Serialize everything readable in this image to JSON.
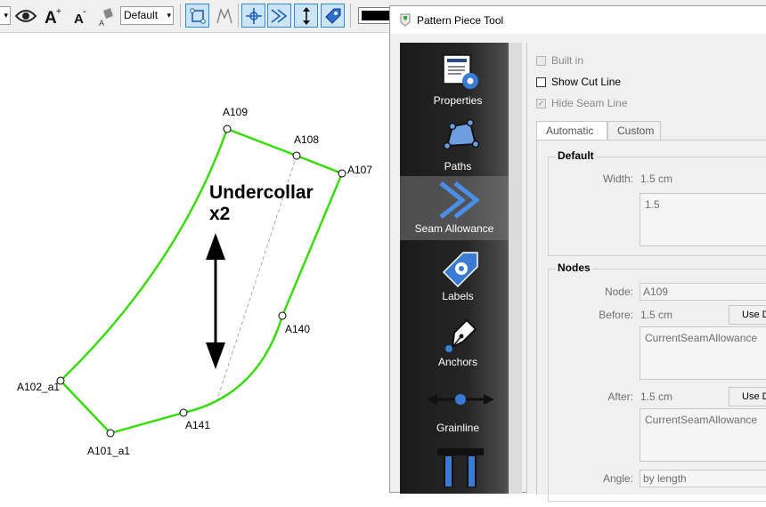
{
  "toolbar": {
    "combo_partial_arrow": "▾",
    "line_type_combo": {
      "value": "Default"
    },
    "colors": {
      "accent": "#2e8ad8",
      "active_bg": "#cce4f7",
      "line_color": "#000000"
    }
  },
  "canvas": {
    "piece": {
      "name_line1": "Undercollar",
      "name_line2": "x2",
      "outline_color": "#33dd00",
      "points": {
        "A109": "A109",
        "A108": "A108",
        "A107": "A107",
        "A140": "A140",
        "A141": "A141",
        "A101_a1": "A101_a1",
        "A102_a1": "A102_a1"
      }
    }
  },
  "dialog": {
    "title": "Pattern Piece Tool",
    "sidebar": {
      "items": [
        {
          "label": "Properties",
          "icon": "properties-icon"
        },
        {
          "label": "Paths",
          "icon": "paths-icon"
        },
        {
          "label": "Seam Allowance",
          "icon": "seam-allowance-icon",
          "selected": true
        },
        {
          "label": "Labels",
          "icon": "labels-icon"
        },
        {
          "label": "Anchors",
          "icon": "anchors-icon"
        },
        {
          "label": "Grainline",
          "icon": "grainline-icon"
        },
        {
          "label": "",
          "icon": "pins-icon"
        }
      ]
    },
    "panel": {
      "built_in": {
        "label": "Built in",
        "checked": false,
        "enabled": false
      },
      "show_cut_line": {
        "label": "Show Cut Line",
        "checked": false,
        "enabled": true
      },
      "hide_seam_line": {
        "label": "Hide Seam Line",
        "checked": true,
        "enabled": false,
        "check_glyph": "✓"
      },
      "tabs": [
        "Automatic",
        "Custom"
      ],
      "default_group": {
        "title": "Default",
        "width_label": "Width:",
        "width_value": "1.5 cm",
        "width_formula": "1.5"
      },
      "nodes_group": {
        "title": "Nodes",
        "node_label": "Node:",
        "node_value": "A109",
        "before_label": "Before:",
        "before_value": "1.5 cm",
        "before_button": "Use Default",
        "before_formula": "CurrentSeamAllowance",
        "after_label": "After:",
        "after_value": "1.5 cm",
        "after_button": "Use Default",
        "after_formula": "CurrentSeamAllowance",
        "angle_label": "Angle:",
        "angle_value": "by length"
      }
    }
  }
}
